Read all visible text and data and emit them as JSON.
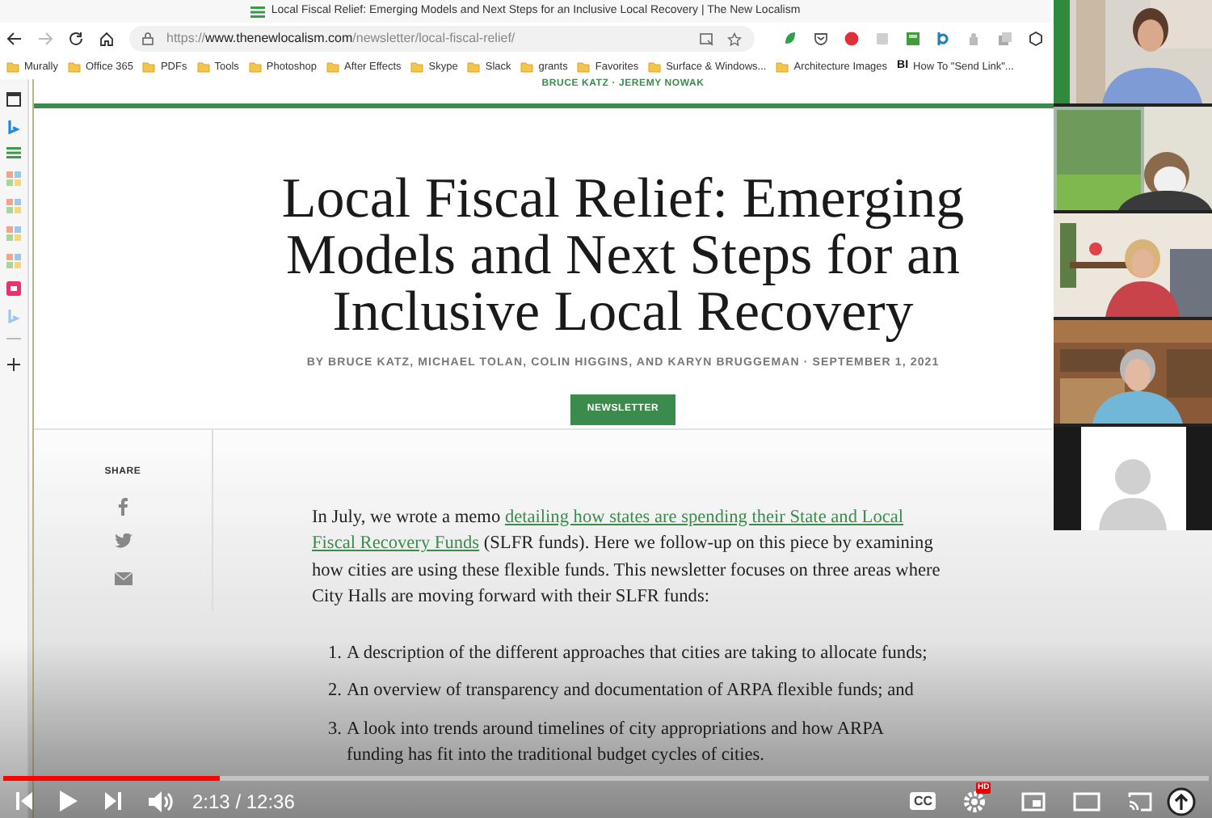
{
  "tab": {
    "title": "Local Fiscal Relief: Emerging Models and Next Steps for an Inclusive Local Recovery | The New Localism"
  },
  "address_bar": {
    "url": "https://**www.thenewlocalism.com**/newsletter/local-fiscal-relief/"
  },
  "bookmarks": [
    {
      "label": "Murally",
      "kind": "folder"
    },
    {
      "label": "Office 365",
      "kind": "folder"
    },
    {
      "label": "PDFs",
      "kind": "folder"
    },
    {
      "label": "Tools",
      "kind": "folder"
    },
    {
      "label": "Photoshop",
      "kind": "folder"
    },
    {
      "label": "After Effects",
      "kind": "folder"
    },
    {
      "label": "Skype",
      "kind": "folder"
    },
    {
      "label": "Slack",
      "kind": "folder"
    },
    {
      "label": "grants",
      "kind": "folder"
    },
    {
      "label": "Favorites",
      "kind": "folder"
    },
    {
      "label": "Surface & Windows...",
      "kind": "folder"
    },
    {
      "label": "Architecture Images",
      "kind": "folder"
    },
    {
      "label": "How To \"Send Link\"...",
      "kind": "page",
      "icon_text": "BI"
    }
  ],
  "article": {
    "top_authors": "BRUCE KATZ · JEREMY NOWAK",
    "title": "Local Fiscal Relief: Emerging Models and Next Steps for an Inclusive Local Recovery",
    "byline": "BY BRUCE KATZ, MICHAEL TOLAN, COLIN HIGGINS, AND KARYN BRUGGEMAN · SEPTEMBER 1, 2021",
    "tag": "NEWSLETTER",
    "share_label": "SHARE",
    "intro_before": "In July, we wrote a memo ",
    "intro_link_lines": [
      "detailing how states are spending their State and Local",
      "Fiscal Recovery Funds"
    ],
    "intro_after": " (SLFR funds). Here we follow-up on this piece by examining how cities are using these flexible funds. This newsletter focuses on three areas where City Halls are moving forward with their SLFR funds:",
    "list": [
      {
        "number": "1.",
        "text": "A description of the different approaches that cities are taking to allocate funds;"
      },
      {
        "number": "2.",
        "text": "An overview of transparency and documentation of ARPA flexible funds; and"
      },
      {
        "number": "3.",
        "text": "A look into trends around timelines of city appropriations and how ARPA funding has fit into the traditional budget cycles of cities."
      }
    ]
  },
  "participants": [
    {
      "kind": "picture"
    },
    {
      "kind": "picture"
    },
    {
      "kind": "picture"
    },
    {
      "kind": "picture"
    },
    {
      "kind": "avatar"
    }
  ],
  "player": {
    "progress": {
      "level": 0.18
    },
    "time": "2:13 / 12:36",
    "cc_label": "CC",
    "hd_badge": "HD"
  }
}
